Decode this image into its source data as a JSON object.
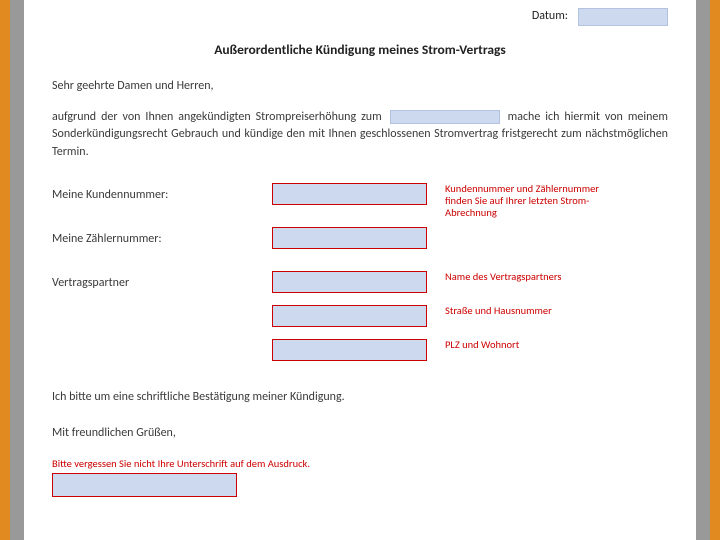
{
  "date_label": "Datum:",
  "title": "Außerordentliche Kündigung meines Strom-Vertrags",
  "salutation": "Sehr geehrte Damen und Herren,",
  "body_pre": "aufgrund der von Ihnen angekündigten Strompreiserhöhung zum ",
  "body_post": " mache ich hiermit von meinem Sonderkündigungsrecht Gebrauch und kündige den mit Ihnen geschlossenen Stromvertrag fristgerecht zum nächstmöglichen Termin.",
  "labels": {
    "kundennummer": "Meine Kundennummer:",
    "zaehlernummer": "Meine Zählernummer:",
    "vertragspartner": "Vertragspartner"
  },
  "hints": {
    "kunden_zaehler": "Kundennummer und Zählernummer finden Sie auf Ihrer letzten Strom-Abrechnung",
    "name": "Name des Vertragspartners",
    "strasse": "Straße und Hausnummer",
    "plz": "PLZ und Wohnort"
  },
  "confirmation": "Ich bitte um eine schriftliche Bestätigung meiner Kündigung.",
  "closing": "Mit freundlichen Grüßen,",
  "signature_hint": "Bitte vergessen Sie nicht Ihre Unterschrift auf dem Ausdruck."
}
